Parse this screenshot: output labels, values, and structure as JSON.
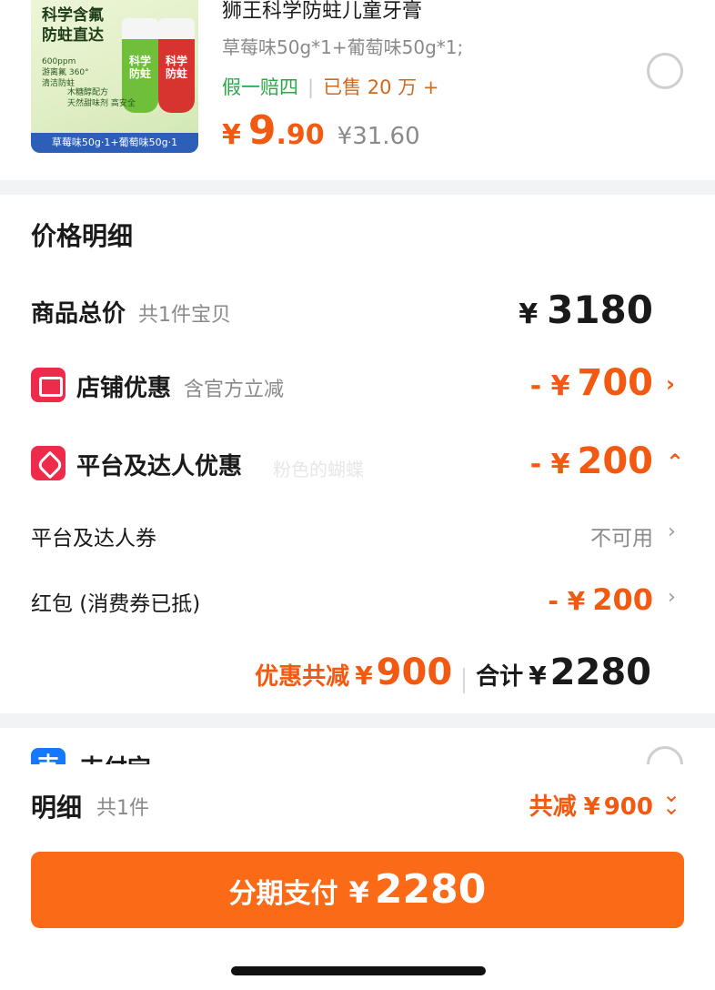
{
  "product": {
    "title": "狮王科学防蛀儿童牙膏",
    "spec": "草莓味50g*1+葡萄味50g*1;",
    "tag_guarantee": "假一赔四",
    "tag_sold": "已售 20 万 +",
    "currency": "¥",
    "price_int": "9",
    "price_dec": ".90",
    "price_original": "¥31.60",
    "image": {
      "headline": "科学含氟\n防蛀直达",
      "tube_text": "科学\n防蛀",
      "note_a": "600ppm\n游离氟  360°\n清洁防蛀",
      "note_b": "木糖醇配方\n天然甜味剂 高安全",
      "banner": "草莓味50g·1+葡萄味50g·1"
    }
  },
  "detail": {
    "title": "价格明细",
    "total_label": "商品总价",
    "total_sub": "共1件宝贝",
    "total_value": "3180",
    "shop_label": "店铺优惠",
    "shop_sub": "含官方立减",
    "shop_value": "700",
    "platform_label": "平台及达人优惠",
    "platform_value": "200",
    "coupon_label": "平台及达人券",
    "coupon_value": "不可用",
    "redpack_label": "红包 (消费券已抵)",
    "redpack_value": "200",
    "minus": "- ¥",
    "currency": "¥",
    "discount_label": "优惠共减",
    "discount_value": "900",
    "sum_label": "合计",
    "sum_value": "2280"
  },
  "watermark": "粉色的蝴蝶",
  "payment": {
    "name": "支付宝",
    "icon_char": "支"
  },
  "bottom": {
    "detail_label": "明细",
    "detail_count": "共1件",
    "save_label": "共减",
    "save_value": "900",
    "button_label": "分期支付",
    "button_value": "2280",
    "currency": "¥"
  },
  "icons": {
    "shop": "store-icon",
    "platform": "tag-icon",
    "chevron_right": "chevron-right-icon",
    "chevron_up": "chevron-up-icon",
    "chevron_double_down": "chevron-double-down-icon"
  },
  "colors": {
    "accent": "#f25a12",
    "button": "#fa6a17",
    "badge_red": "#ee2b4a",
    "green": "#2aa84a",
    "alipay": "#1677ff"
  }
}
